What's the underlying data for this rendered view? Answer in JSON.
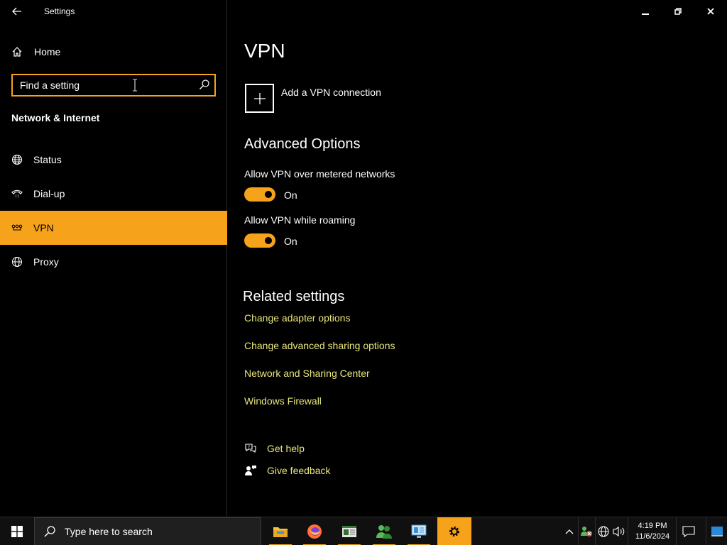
{
  "window": {
    "title": "Settings",
    "controls": {
      "minimize": "minimize",
      "restore": "restore",
      "close": "close"
    }
  },
  "sidebar": {
    "home_label": "Home",
    "search_placeholder": "Find a setting",
    "section_title": "Network & Internet",
    "items": [
      {
        "label": "Status",
        "icon": "globe-status-icon",
        "active": false
      },
      {
        "label": "Dial-up",
        "icon": "dial-up-icon",
        "active": false
      },
      {
        "label": "VPN",
        "icon": "vpn-icon",
        "active": true
      },
      {
        "label": "Proxy",
        "icon": "globe-icon",
        "active": false
      }
    ]
  },
  "main": {
    "title": "VPN",
    "add_vpn_label": "Add a VPN connection",
    "advanced_title": "Advanced Options",
    "options": [
      {
        "label": "Allow VPN over metered networks",
        "state": "On",
        "enabled": true
      },
      {
        "label": "Allow VPN while roaming",
        "state": "On",
        "enabled": true
      }
    ],
    "related_title": "Related settings",
    "related_links": [
      "Change adapter options",
      "Change advanced sharing options",
      "Network and Sharing Center",
      "Windows Firewall"
    ],
    "help": {
      "get_help": "Get help",
      "give_feedback": "Give feedback"
    }
  },
  "taskbar": {
    "search_placeholder": "Type here to search",
    "time": "4:19 PM",
    "date": "11/6/2024"
  },
  "colors": {
    "accent": "#f7a21b",
    "link": "#e8e67c",
    "background": "#000000"
  }
}
